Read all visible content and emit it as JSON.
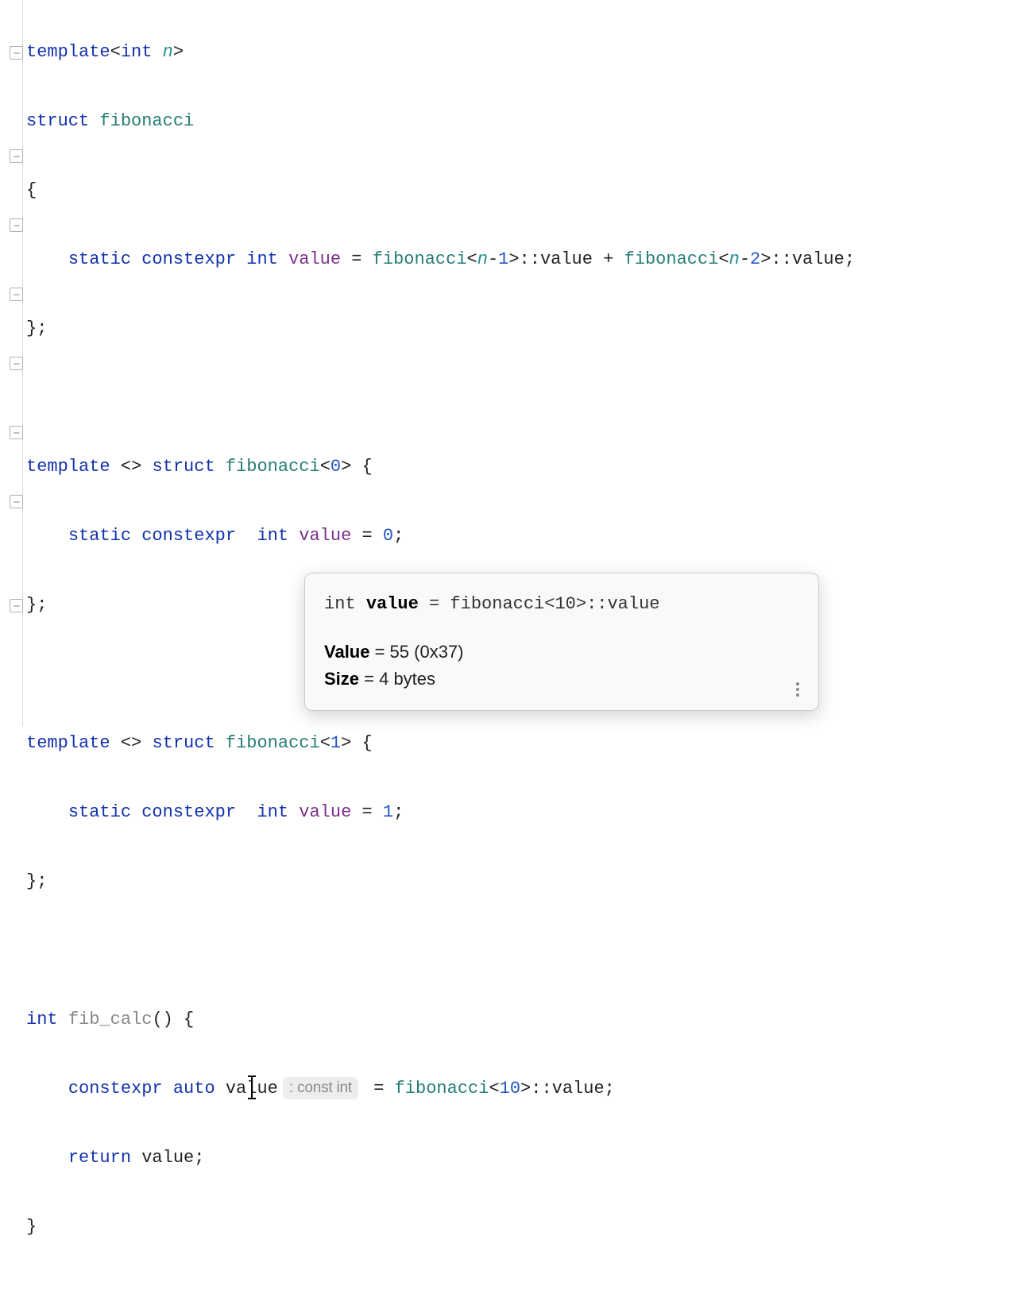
{
  "code": {
    "line1": {
      "template": "template",
      "lt": "<",
      "int": "int",
      "n": "n",
      "gt": ">"
    },
    "line2": {
      "struct": "struct",
      "fibonacci": "fibonacci"
    },
    "line3": {
      "brace": "{"
    },
    "line4": {
      "static": "static",
      "constexpr": "constexpr",
      "int": "int",
      "value": "value",
      "eq": " = ",
      "fib1": "fibonacci",
      "lt1": "<",
      "n1": "n",
      "minus1": "-",
      "one": "1",
      "gt1": ">",
      "scope1": "::",
      "val1": "value",
      "plus": " + ",
      "fib2": "fibonacci",
      "lt2": "<",
      "n2": "n",
      "minus2": "-",
      "two": "2",
      "gt2": ">",
      "scope2": "::",
      "val2": "value",
      "semi": ";"
    },
    "line5": {
      "brace_semi": "};"
    },
    "line7": {
      "template": "template",
      "empty": " <> ",
      "struct": "struct",
      "fibonacci": "fibonacci",
      "lt": "<",
      "zero": "0",
      "gt": ">",
      "brace": " {"
    },
    "line8": {
      "static": "static",
      "constexpr": "constexpr",
      "int": "int",
      "value": "value",
      "eq": " = ",
      "zero": "0",
      "semi": ";"
    },
    "line9": {
      "brace_semi": "};"
    },
    "line11": {
      "template": "template",
      "empty": " <> ",
      "struct": "struct",
      "fibonacci": "fibonacci",
      "lt": "<",
      "one": "1",
      "gt": ">",
      "brace": " {"
    },
    "line12": {
      "static": "static",
      "constexpr": "constexpr",
      "int": "int",
      "value": "value",
      "eq": " = ",
      "one": "1",
      "semi": ";"
    },
    "line13": {
      "brace_semi": "};"
    },
    "line15": {
      "int": "int",
      "fn": "fib_calc",
      "parens": "() {",
      "space": " "
    },
    "line16": {
      "constexpr": "constexpr",
      "auto": "auto",
      "val_before": "val",
      "val_after": "ue",
      "inlay": ": const int",
      "eq": " = ",
      "fib": "fibonacci",
      "lt": "<",
      "ten": "10",
      "gt": ">",
      "scope": "::",
      "value": "value",
      "semi": ";"
    },
    "line17": {
      "return": "return",
      "value": "value",
      "semi": ";"
    },
    "line18": {
      "brace": "}"
    }
  },
  "tooltip": {
    "defn_type": "int ",
    "defn_name": "value",
    "defn_rest": " = fibonacci<10>::value",
    "value_label": "Value",
    "value_text": " = 55 (0x37)",
    "size_label": "Size",
    "size_text": " = 4 bytes"
  }
}
